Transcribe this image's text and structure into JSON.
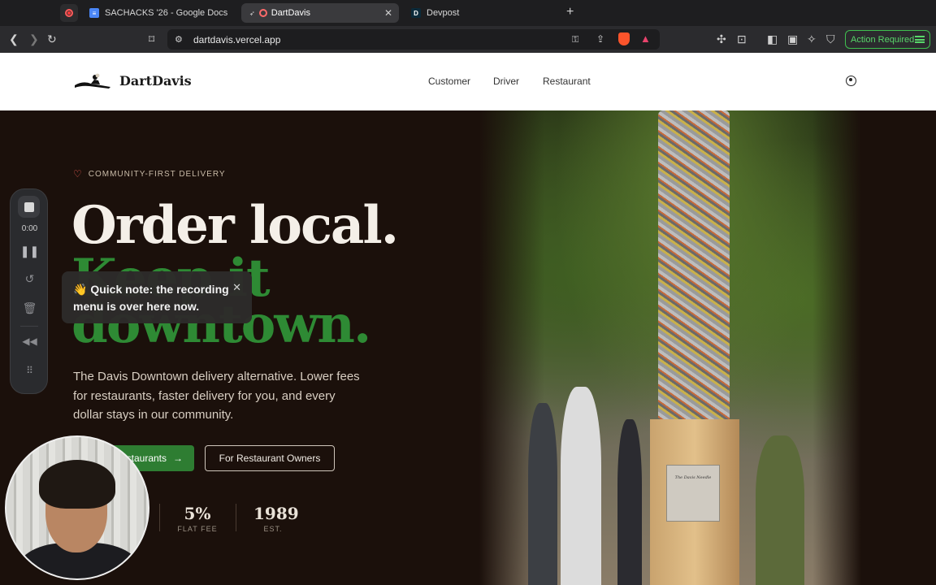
{
  "browser": {
    "tabs": [
      {
        "label": "SACHACKS '26 - Google Docs",
        "icon": "google-docs-icon"
      },
      {
        "label": "DartDavis",
        "icon": "dartdavis-favicon",
        "active": true
      },
      {
        "label": "Devpost",
        "icon": "devpost-icon",
        "favicon_text": "D"
      }
    ],
    "new_tab_symbol": "+",
    "close_symbol": "✕",
    "url": "dartdavis.vercel.app",
    "action_required": "Action Required"
  },
  "site": {
    "brand": "DartDavis",
    "nav": [
      "Customer",
      "Driver",
      "Restaurant"
    ]
  },
  "hero": {
    "tagline": "COMMUNITY-FIRST DELIVERY",
    "heading_line1": "Order local.",
    "heading_line2": "Keep it",
    "heading_line3": "downtown.",
    "lede": "The Davis Downtown delivery alternative. Lower fees for restaurants, faster delivery for you, and every dollar stays in our community.",
    "primary_cta": "Browse Restaurants",
    "secondary_cta": "For Restaurant Owners",
    "stats": [
      {
        "value": "5%",
        "label": "FLAT FEE"
      },
      {
        "value": "1989",
        "label": "EST."
      }
    ],
    "plaque_text": "The Davis Needle"
  },
  "recording": {
    "time": "0:00",
    "toast": "👋 Quick note: the recording menu is over here now."
  },
  "colors": {
    "accent_green": "#2e7d32",
    "heading_green": "#2e8a34",
    "hero_bg": "#1b100b",
    "action_green": "#58d66a"
  }
}
